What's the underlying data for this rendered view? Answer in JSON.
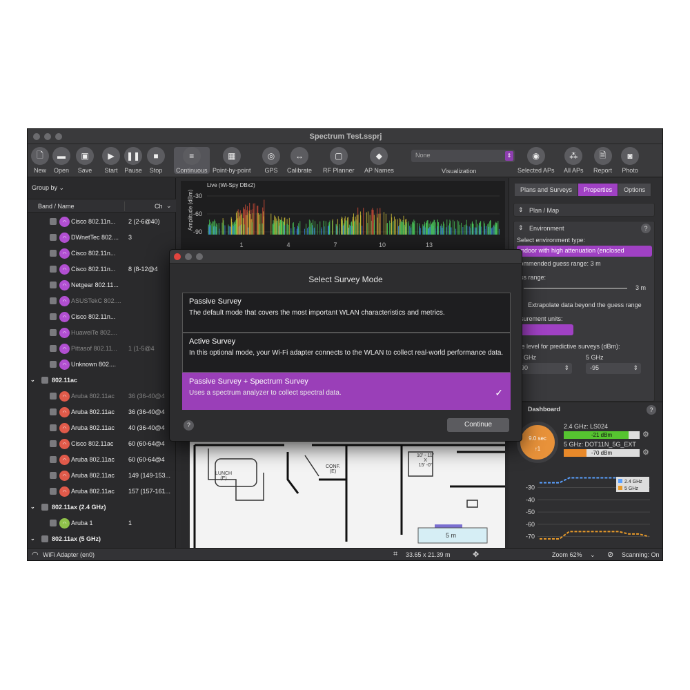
{
  "window": {
    "title": "Spectrum Test.ssprj"
  },
  "toolbar": {
    "items": [
      {
        "label": "New",
        "icon": "document-icon",
        "glyph": "🗋"
      },
      {
        "label": "Open",
        "icon": "folder-icon",
        "glyph": "▬"
      },
      {
        "label": "Save",
        "icon": "save-icon",
        "glyph": "▣"
      },
      {
        "label": "Start",
        "icon": "play-icon",
        "glyph": "▶"
      },
      {
        "label": "Pause",
        "icon": "pause-icon",
        "glyph": "❚❚"
      },
      {
        "label": "Stop",
        "icon": "stop-icon",
        "glyph": "■"
      },
      {
        "label": "Continuous",
        "icon": "continuous-icon",
        "glyph": "≡"
      },
      {
        "label": "Point-by-point",
        "icon": "grid-icon",
        "glyph": "▦"
      },
      {
        "label": "GPS",
        "icon": "gps-icon",
        "glyph": "◎"
      },
      {
        "label": "Calibrate",
        "icon": "calibrate-icon",
        "glyph": "↔"
      },
      {
        "label": "RF Planner",
        "icon": "rf-planner-icon",
        "glyph": "▢"
      },
      {
        "label": "AP Names",
        "icon": "tag-icon",
        "glyph": "◆"
      },
      {
        "label": "Selected APs",
        "icon": "selected-aps-icon",
        "glyph": "◉"
      },
      {
        "label": "All APs",
        "icon": "all-aps-icon",
        "glyph": "⁂"
      },
      {
        "label": "Report",
        "icon": "report-icon",
        "glyph": "🗎"
      },
      {
        "label": "Photo",
        "icon": "camera-icon",
        "glyph": "◙"
      }
    ],
    "visualization_value": "None",
    "visualization_label": "Visualization"
  },
  "sidebar": {
    "group_by": "Group by",
    "col_band": "Band / Name",
    "col_ch": "Ch",
    "rows": [
      {
        "type": "ap",
        "name": "Cisco 802.11n...",
        "ch": "2 (2-6@40)",
        "color": "#b14fd1",
        "dim": false
      },
      {
        "type": "ap",
        "name": "DWnetTec 802....",
        "ch": "3",
        "color": "#b14fd1",
        "dim": false
      },
      {
        "type": "ap",
        "name": "Cisco 802.11n...",
        "ch": "",
        "color": "#b14fd1",
        "dim": false
      },
      {
        "type": "ap",
        "name": "Cisco 802.11n...",
        "ch": "8 (8-12@4",
        "color": "#b14fd1",
        "dim": false
      },
      {
        "type": "ap",
        "name": "Netgear 802.11...",
        "ch": "",
        "color": "#b14fd1",
        "dim": false
      },
      {
        "type": "ap",
        "name": "ASUSTekC 802....",
        "ch": "",
        "color": "#b14fd1",
        "dim": true
      },
      {
        "type": "ap",
        "name": "Cisco 802.11n...",
        "ch": "",
        "color": "#b14fd1",
        "dim": false
      },
      {
        "type": "ap",
        "name": "HuaweiTe 802....",
        "ch": "",
        "color": "#b14fd1",
        "dim": true
      },
      {
        "type": "ap",
        "name": "Pittasof 802.11...",
        "ch": "1 (1-5@4",
        "color": "#b14fd1",
        "dim": true
      },
      {
        "type": "ap",
        "name": "Unknown 802....",
        "ch": "",
        "color": "#b14fd1",
        "dim": false
      },
      {
        "type": "group",
        "name": "802.11ac",
        "ch": ""
      },
      {
        "type": "ap",
        "name": "Aruba 802.11ac",
        "ch": "36 (36-40@4",
        "color": "#e05a4a",
        "dim": true
      },
      {
        "type": "ap",
        "name": "Aruba 802.11ac",
        "ch": "36 (36-40@4",
        "color": "#e05a4a",
        "dim": false
      },
      {
        "type": "ap",
        "name": "Aruba 802.11ac",
        "ch": "40 (36-40@4",
        "color": "#e05a4a",
        "dim": false
      },
      {
        "type": "ap",
        "name": "Cisco 802.11ac",
        "ch": "60 (60-64@4",
        "color": "#e05a4a",
        "dim": false
      },
      {
        "type": "ap",
        "name": "Aruba 802.11ac",
        "ch": "60 (60-64@4",
        "color": "#e05a4a",
        "dim": false
      },
      {
        "type": "ap",
        "name": "Aruba 802.11ac",
        "ch": "149 (149-153...",
        "color": "#e05a4a",
        "dim": false
      },
      {
        "type": "ap",
        "name": "Aruba 802.11ac",
        "ch": "157 (157-161...",
        "color": "#e05a4a",
        "dim": false
      },
      {
        "type": "group",
        "name": "802.11ax (2.4 GHz)",
        "ch": ""
      },
      {
        "type": "ap",
        "name": "Aruba 1",
        "ch": "1",
        "color": "#8fc24a",
        "dim": false
      },
      {
        "type": "group",
        "name": "802.11ax (5 GHz)",
        "ch": ""
      }
    ]
  },
  "spectrum": {
    "title": "Live (Wi-Spy DBx2)",
    "ylabel": "Amplitude (dBm)",
    "yticks": [
      "-30",
      "-60",
      "-90"
    ],
    "xticks": [
      "1",
      "4",
      "7",
      "10",
      "13"
    ]
  },
  "floorplan": {
    "labels": [
      "LUNCH\n(E)",
      "CONF.\n(E)",
      "10' - 11\"\nX\n15' -0\"",
      "5 m"
    ]
  },
  "right_panel": {
    "tabs": [
      "Plans and Surveys",
      "Properties",
      "Options"
    ],
    "active_tab": "Properties",
    "plan_map": "Plan / Map",
    "environment": "Environment",
    "env_type_label": "Select environment type:",
    "env_type_value": "ndoor with high attenuation (enclosed",
    "guess_recommend": "commended guess range: 3 m",
    "guess_range_label": "ess range:",
    "guess_range_value": "3 m",
    "extrapolate": "Extrapolate data beyond the guess range",
    "units_label": "asurement units:",
    "noise_label": "ise level for predictive surveys (dBm):",
    "band_24": "GHz",
    "band_5": "5 GHz",
    "noise_24": "90",
    "noise_5": "-95"
  },
  "dashboard": {
    "title": "Dashboard",
    "gauge_top": "9.0 sec",
    "gauge_bottom": "↑1",
    "ap24_label": "2.4 GHz: LS024",
    "ap24_value": "-21 dBm",
    "ap24_frac": 0.85,
    "ap5_label": "5 GHz: DOT11N_5G_EXT",
    "ap5_value": "-70 dBm",
    "ap5_frac": 0.3,
    "chart": {
      "type": "line",
      "yticks": [
        "-30",
        "-40",
        "-50",
        "-60",
        "-70"
      ],
      "ylim": [
        -72,
        -20
      ],
      "legend": [
        "2.4 GHz",
        "5 GHz"
      ],
      "series": [
        {
          "name": "2.4 GHz",
          "color": "#5aa0ff",
          "values": [
            -26,
            -26,
            -26,
            -22,
            -22,
            -22,
            -22,
            -22,
            -22,
            -22,
            -22,
            -22
          ]
        },
        {
          "name": "5 GHz",
          "color": "#e89a2a",
          "values": [
            -72,
            -72,
            -72,
            -66,
            -66,
            -66,
            -66,
            -66,
            -66,
            -68,
            -68,
            -70
          ]
        }
      ]
    }
  },
  "statusbar": {
    "adapter": "WiFi Adapter (en0)",
    "dimensions": "33.65 x 21.39 m",
    "zoom": "Zoom 62%",
    "scanning": "Scanning: On"
  },
  "modal": {
    "title": "Select Survey Mode",
    "options": [
      {
        "title": "Passive Survey",
        "desc": "The default mode that covers the most important WLAN characteristics and metrics.",
        "selected": false
      },
      {
        "title": "Active Survey",
        "desc": "In this optional mode, your Wi-Fi adapter connects to the WLAN to collect real-world performance data.",
        "selected": false
      },
      {
        "title": "Passive Survey + Spectrum Survey",
        "desc": "Uses a spectrum analyzer to collect spectral data.",
        "selected": true
      }
    ],
    "check": "✓",
    "help": "?",
    "continue": "Continue"
  }
}
